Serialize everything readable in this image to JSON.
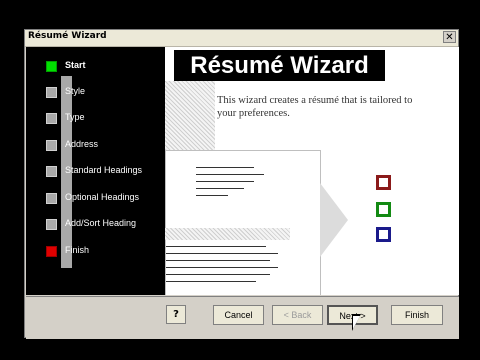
{
  "window": {
    "title": "Résumé Wizard",
    "close_glyph": "✕"
  },
  "steps": [
    {
      "label": "Start",
      "state": "done"
    },
    {
      "label": "Style",
      "state": "pending"
    },
    {
      "label": "Type",
      "state": "pending"
    },
    {
      "label": "Address",
      "state": "pending"
    },
    {
      "label": "Standard Headings",
      "state": "pending"
    },
    {
      "label": "Optional Headings",
      "state": "pending"
    },
    {
      "label": "Add/Sort Heading",
      "state": "pending"
    },
    {
      "label": "Finish",
      "state": "end"
    }
  ],
  "content": {
    "banner": "Résumé Wizard",
    "description": "This wizard creates a résumé that is tailored to your preferences.",
    "boxes": [
      {
        "color": "#8b1a1a",
        "name": "red-square-icon"
      },
      {
        "color": "#138a13",
        "name": "green-square-icon"
      },
      {
        "color": "#1a1a8b",
        "name": "blue-square-icon"
      }
    ]
  },
  "footer": {
    "help_icon": "?",
    "cancel": "Cancel",
    "back": "< Back",
    "next": "Next >",
    "finish": "Finish"
  }
}
